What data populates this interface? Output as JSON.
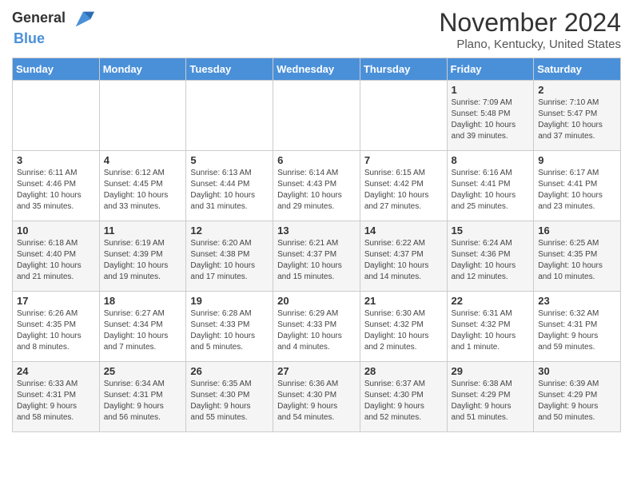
{
  "header": {
    "logo_general": "General",
    "logo_blue": "Blue",
    "month_title": "November 2024",
    "location": "Plano, Kentucky, United States"
  },
  "days_of_week": [
    "Sunday",
    "Monday",
    "Tuesday",
    "Wednesday",
    "Thursday",
    "Friday",
    "Saturday"
  ],
  "weeks": [
    [
      {
        "day": "",
        "info": ""
      },
      {
        "day": "",
        "info": ""
      },
      {
        "day": "",
        "info": ""
      },
      {
        "day": "",
        "info": ""
      },
      {
        "day": "",
        "info": ""
      },
      {
        "day": "1",
        "info": "Sunrise: 7:09 AM\nSunset: 5:48 PM\nDaylight: 10 hours\nand 39 minutes."
      },
      {
        "day": "2",
        "info": "Sunrise: 7:10 AM\nSunset: 5:47 PM\nDaylight: 10 hours\nand 37 minutes."
      }
    ],
    [
      {
        "day": "3",
        "info": "Sunrise: 6:11 AM\nSunset: 4:46 PM\nDaylight: 10 hours\nand 35 minutes."
      },
      {
        "day": "4",
        "info": "Sunrise: 6:12 AM\nSunset: 4:45 PM\nDaylight: 10 hours\nand 33 minutes."
      },
      {
        "day": "5",
        "info": "Sunrise: 6:13 AM\nSunset: 4:44 PM\nDaylight: 10 hours\nand 31 minutes."
      },
      {
        "day": "6",
        "info": "Sunrise: 6:14 AM\nSunset: 4:43 PM\nDaylight: 10 hours\nand 29 minutes."
      },
      {
        "day": "7",
        "info": "Sunrise: 6:15 AM\nSunset: 4:42 PM\nDaylight: 10 hours\nand 27 minutes."
      },
      {
        "day": "8",
        "info": "Sunrise: 6:16 AM\nSunset: 4:41 PM\nDaylight: 10 hours\nand 25 minutes."
      },
      {
        "day": "9",
        "info": "Sunrise: 6:17 AM\nSunset: 4:41 PM\nDaylight: 10 hours\nand 23 minutes."
      }
    ],
    [
      {
        "day": "10",
        "info": "Sunrise: 6:18 AM\nSunset: 4:40 PM\nDaylight: 10 hours\nand 21 minutes."
      },
      {
        "day": "11",
        "info": "Sunrise: 6:19 AM\nSunset: 4:39 PM\nDaylight: 10 hours\nand 19 minutes."
      },
      {
        "day": "12",
        "info": "Sunrise: 6:20 AM\nSunset: 4:38 PM\nDaylight: 10 hours\nand 17 minutes."
      },
      {
        "day": "13",
        "info": "Sunrise: 6:21 AM\nSunset: 4:37 PM\nDaylight: 10 hours\nand 15 minutes."
      },
      {
        "day": "14",
        "info": "Sunrise: 6:22 AM\nSunset: 4:37 PM\nDaylight: 10 hours\nand 14 minutes."
      },
      {
        "day": "15",
        "info": "Sunrise: 6:24 AM\nSunset: 4:36 PM\nDaylight: 10 hours\nand 12 minutes."
      },
      {
        "day": "16",
        "info": "Sunrise: 6:25 AM\nSunset: 4:35 PM\nDaylight: 10 hours\nand 10 minutes."
      }
    ],
    [
      {
        "day": "17",
        "info": "Sunrise: 6:26 AM\nSunset: 4:35 PM\nDaylight: 10 hours\nand 8 minutes."
      },
      {
        "day": "18",
        "info": "Sunrise: 6:27 AM\nSunset: 4:34 PM\nDaylight: 10 hours\nand 7 minutes."
      },
      {
        "day": "19",
        "info": "Sunrise: 6:28 AM\nSunset: 4:33 PM\nDaylight: 10 hours\nand 5 minutes."
      },
      {
        "day": "20",
        "info": "Sunrise: 6:29 AM\nSunset: 4:33 PM\nDaylight: 10 hours\nand 4 minutes."
      },
      {
        "day": "21",
        "info": "Sunrise: 6:30 AM\nSunset: 4:32 PM\nDaylight: 10 hours\nand 2 minutes."
      },
      {
        "day": "22",
        "info": "Sunrise: 6:31 AM\nSunset: 4:32 PM\nDaylight: 10 hours\nand 1 minute."
      },
      {
        "day": "23",
        "info": "Sunrise: 6:32 AM\nSunset: 4:31 PM\nDaylight: 9 hours\nand 59 minutes."
      }
    ],
    [
      {
        "day": "24",
        "info": "Sunrise: 6:33 AM\nSunset: 4:31 PM\nDaylight: 9 hours\nand 58 minutes."
      },
      {
        "day": "25",
        "info": "Sunrise: 6:34 AM\nSunset: 4:31 PM\nDaylight: 9 hours\nand 56 minutes."
      },
      {
        "day": "26",
        "info": "Sunrise: 6:35 AM\nSunset: 4:30 PM\nDaylight: 9 hours\nand 55 minutes."
      },
      {
        "day": "27",
        "info": "Sunrise: 6:36 AM\nSunset: 4:30 PM\nDaylight: 9 hours\nand 54 minutes."
      },
      {
        "day": "28",
        "info": "Sunrise: 6:37 AM\nSunset: 4:30 PM\nDaylight: 9 hours\nand 52 minutes."
      },
      {
        "day": "29",
        "info": "Sunrise: 6:38 AM\nSunset: 4:29 PM\nDaylight: 9 hours\nand 51 minutes."
      },
      {
        "day": "30",
        "info": "Sunrise: 6:39 AM\nSunset: 4:29 PM\nDaylight: 9 hours\nand 50 minutes."
      }
    ]
  ]
}
